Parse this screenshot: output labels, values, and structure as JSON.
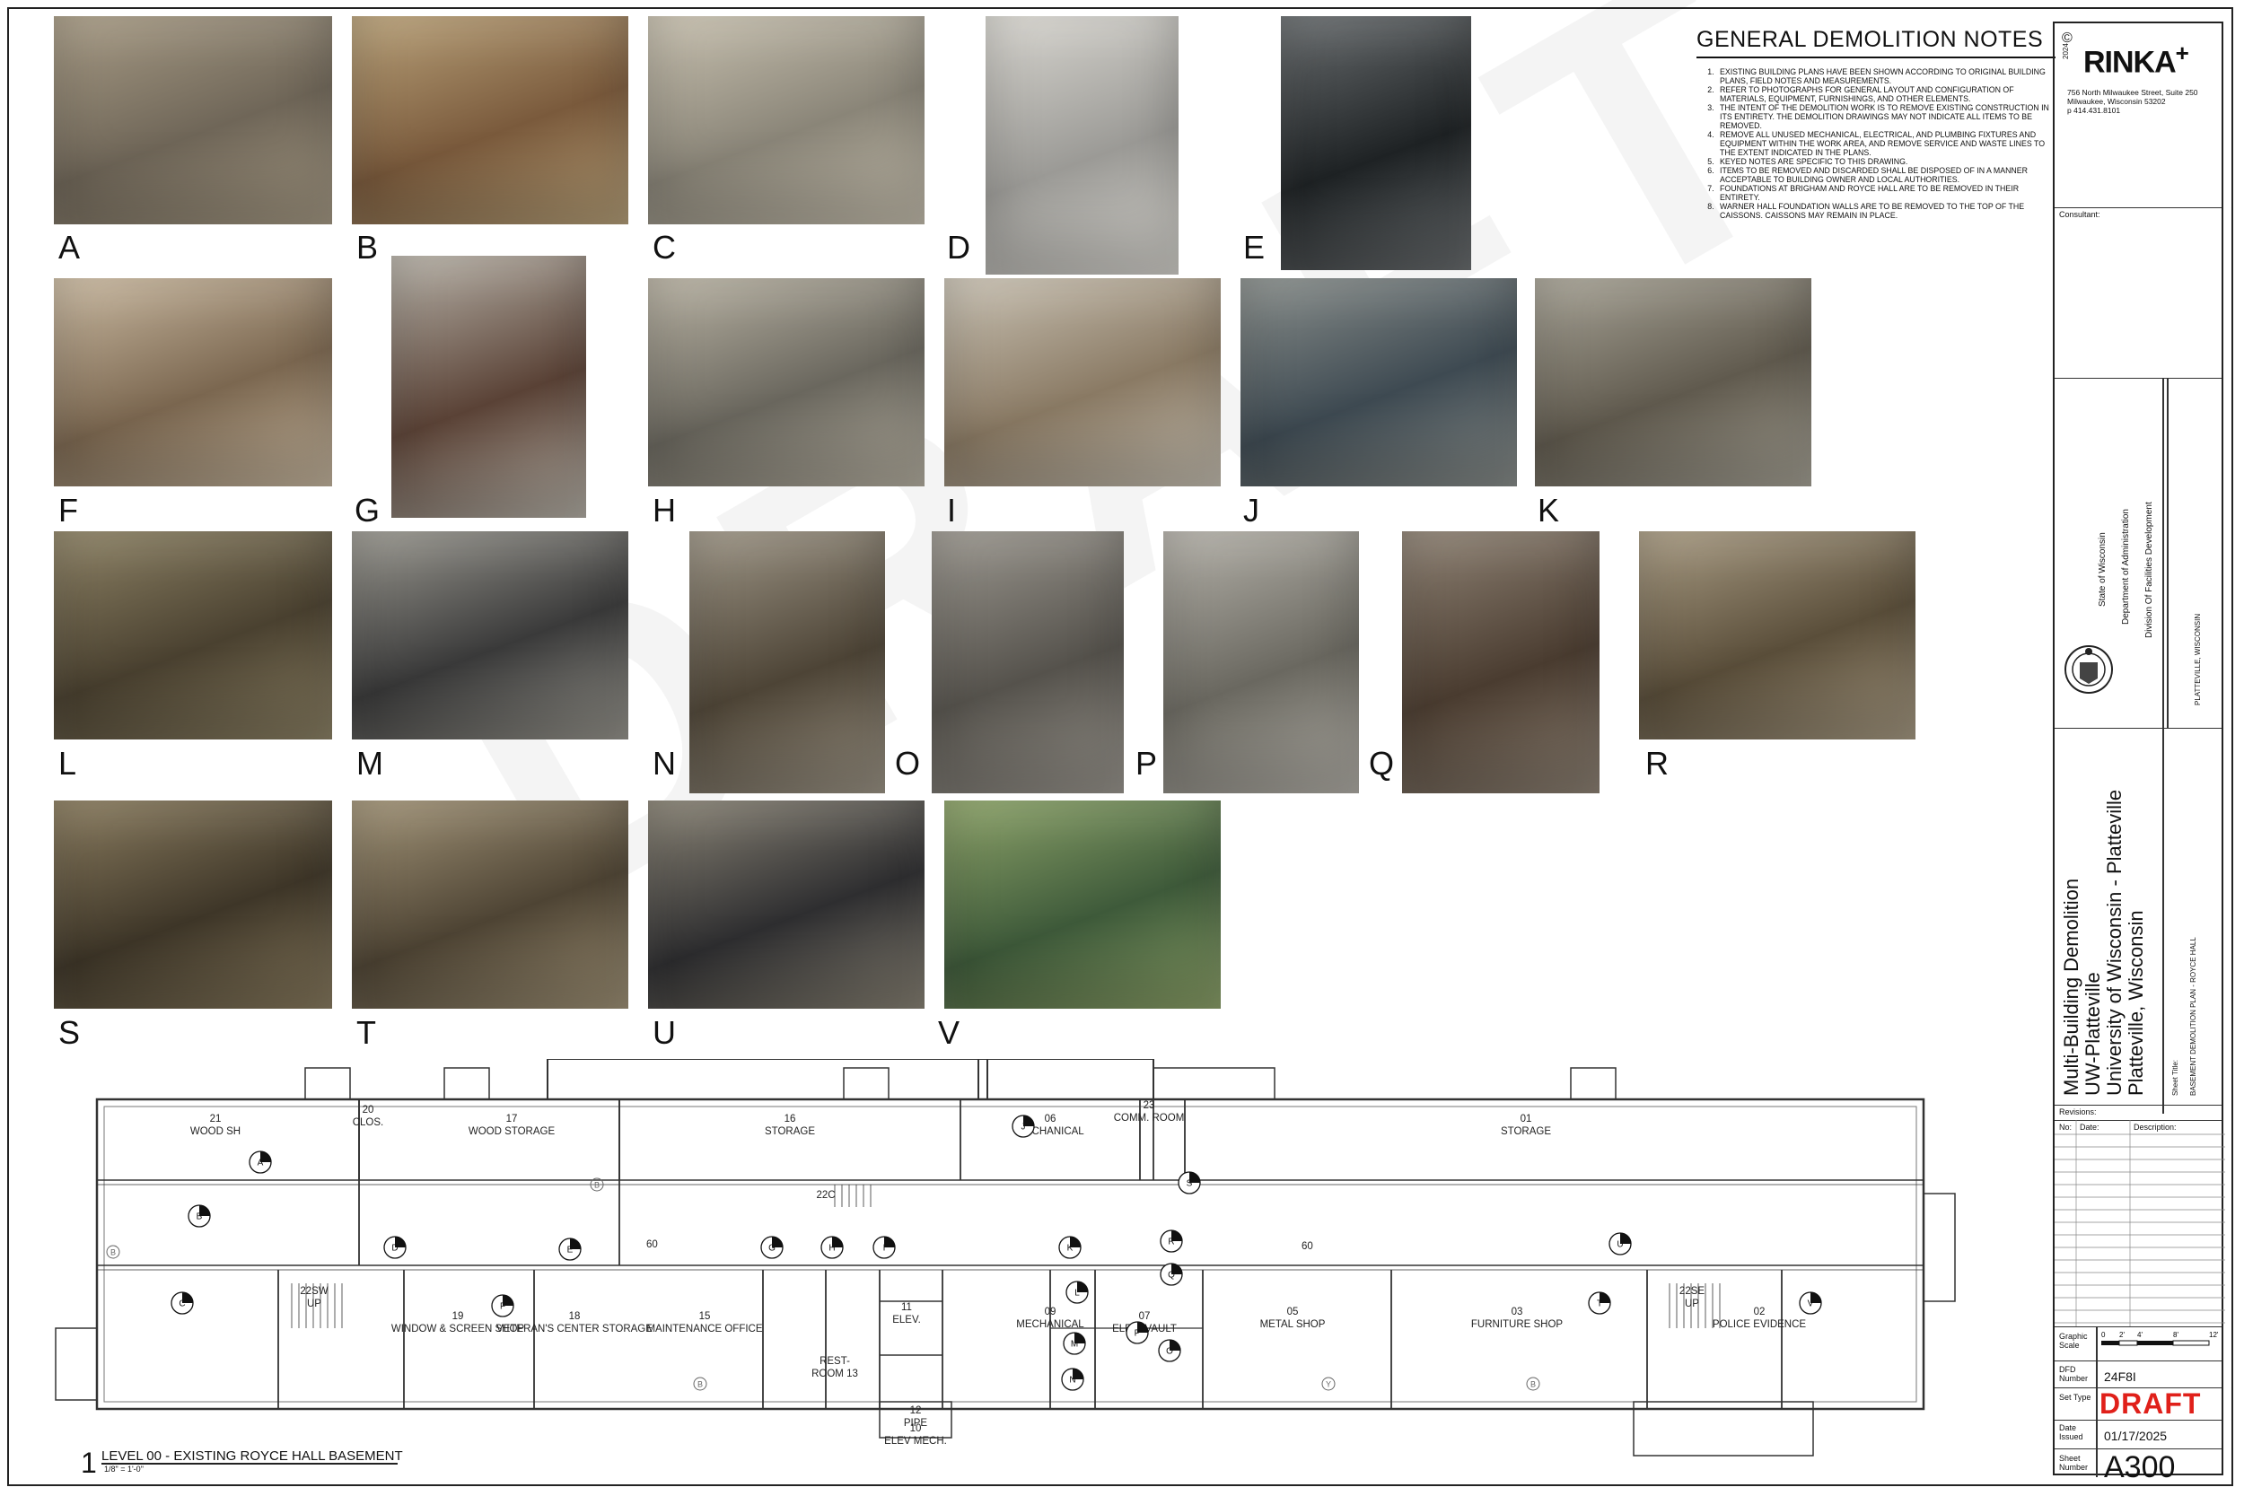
{
  "photos": [
    {
      "label": "A",
      "colors": [
        "#6f6658",
        "#a89c86"
      ]
    },
    {
      "label": "B",
      "colors": [
        "#7a5a3c",
        "#b9a27a"
      ]
    },
    {
      "label": "C",
      "colors": [
        "#8a8578",
        "#c8c1b0"
      ]
    },
    {
      "label": "D",
      "colors": [
        "#9b9a96",
        "#d8d6d0"
      ]
    },
    {
      "label": "E",
      "colors": [
        "#1e2224",
        "#6a6e70"
      ]
    },
    {
      "label": "F",
      "colors": [
        "#7b6750",
        "#c9b9a1"
      ]
    },
    {
      "label": "G",
      "colors": [
        "#5a4236",
        "#b7b2a8"
      ]
    },
    {
      "label": "H",
      "colors": [
        "#6a675e",
        "#b9b3a4"
      ]
    },
    {
      "label": "I",
      "colors": [
        "#8a7a64",
        "#c9c2b4"
      ]
    },
    {
      "label": "J",
      "colors": [
        "#3e4a52",
        "#8a8f8c"
      ]
    },
    {
      "label": "K",
      "colors": [
        "#605a4e",
        "#a8a497"
      ]
    },
    {
      "label": "L",
      "colors": [
        "#4a4130",
        "#8e8366"
      ]
    },
    {
      "label": "M",
      "colors": [
        "#3a3a3a",
        "#9a9890"
      ]
    },
    {
      "label": "N",
      "colors": [
        "#4d4436",
        "#9e9687"
      ]
    },
    {
      "label": "O",
      "colors": [
        "#55524c",
        "#9c9890"
      ]
    },
    {
      "label": "P",
      "colors": [
        "#6a6860",
        "#b5b2aa"
      ]
    },
    {
      "label": "Q",
      "colors": [
        "#4a3c30",
        "#8f8375"
      ]
    },
    {
      "label": "R",
      "colors": [
        "#5a4e3a",
        "#a99c84"
      ]
    },
    {
      "label": "S",
      "colors": [
        "#3e3628",
        "#8b7d60"
      ]
    },
    {
      "label": "T",
      "colors": [
        "#4e4434",
        "#a29478"
      ]
    },
    {
      "label": "U",
      "colors": [
        "#2e2e30",
        "#8a8476"
      ]
    },
    {
      "label": "V",
      "colors": [
        "#3e5a3a",
        "#8ea46a"
      ]
    }
  ],
  "notes": {
    "title": "GENERAL DEMOLITION NOTES",
    "items": [
      "Existing building plans have been shown according to original building plans, field notes and measurements.",
      "Refer to photographs for general layout and configuration of materials, equipment, furnishings, and other elements.",
      "The intent of the demolition work is to remove existing construction in its entirety. The demolition drawings may not indicate all items to be removed.",
      "Remove all unused mechanical, electrical, and plumbing fixtures and equipment within the work area, and remove service and waste lines to the extent indicated in the plans.",
      "Keyed notes are specific to this drawing.",
      "Items to be removed and discarded shall be disposed of in a manner acceptable to building owner and local authorities.",
      "Foundations at Brigham and Royce Hall are to be removed in their entirety.",
      "Warner Hall foundation walls are to be removed to the top of the caissons. Caissons may remain in place."
    ]
  },
  "titleblock": {
    "copyright": "©",
    "year": "2024",
    "firm": "RINKA",
    "firm_plus": "+",
    "address": [
      "756 North Milwaukee Street, Suite 250",
      "Milwaukee, Wisconsin 53202",
      "p 414.431.8101"
    ],
    "consultant_label": "Consultant:",
    "state": [
      "State of Wisconsin",
      "Department of Administration",
      "Division Of Facilities Development"
    ],
    "location": "PLATTEVILLE, WISCONSIN",
    "project_lines": [
      "Multi-Building Demolition",
      "UW-Platteville",
      "University of Wisconsin - Platteville",
      "Platteville, Wisconsin"
    ],
    "sheet_title_label": "Sheet Title:",
    "sheet_title": "BASEMENT DEMOLITION PLAN - ROYCE HALL",
    "revisions_label": "Revisions:",
    "rev_cols": [
      "No:",
      "Date:",
      "Description:"
    ],
    "graphic_scale_label": "Graphic Scale",
    "scale_ticks": [
      "0",
      "2'",
      "4'",
      "8'",
      "12'"
    ],
    "dfd_label": "DFD Number",
    "dfd_value": "24F8I",
    "set_type_label": "Set Type",
    "set_type_value": "DRAFT",
    "date_label": "Date Issued",
    "date_value": "01/17/2025",
    "sheet_number_label": "Sheet Number",
    "sheet_number": "A300"
  },
  "plan": {
    "number": "1",
    "title": "LEVEL 00 - EXISTING ROYCE HALL BASEMENT",
    "scale": "1/8\" = 1'-0\"",
    "watermark": "DRAFT",
    "rooms": [
      {
        "num": "21",
        "name": "WOOD SH"
      },
      {
        "num": "20",
        "name": "CLOS."
      },
      {
        "num": "17",
        "name": "WOOD STORAGE"
      },
      {
        "num": "16",
        "name": "STORAGE"
      },
      {
        "num": "06",
        "name": "MECHANICAL"
      },
      {
        "num": "23",
        "name": "COMM. ROOM"
      },
      {
        "num": "01",
        "name": "STORAGE"
      },
      {
        "num": "22SW",
        "name": "UP"
      },
      {
        "num": "19",
        "name": "WINDOW & SCREEN SHOP"
      },
      {
        "num": "18",
        "name": "VETERAN'S CENTER STORAGE"
      },
      {
        "num": "15",
        "name": "MAINTENANCE OFFICE"
      },
      {
        "num": "22C",
        "name": ""
      },
      {
        "num": "11",
        "name": "ELEV."
      },
      {
        "num": "REST-",
        "name": "ROOM 13"
      },
      {
        "num": "12",
        "name": "PIPE"
      },
      {
        "num": "10",
        "name": "ELEV MECH."
      },
      {
        "num": "09",
        "name": "MECHANICAL"
      },
      {
        "num": "07",
        "name": "ELEC. VAULT"
      },
      {
        "num": "05",
        "name": "METAL SHOP"
      },
      {
        "num": "03",
        "name": "FURNITURE SHOP"
      },
      {
        "num": "22SE",
        "name": "UP"
      },
      {
        "num": "02",
        "name": "POLICE EVIDENCE"
      }
    ],
    "corridor": "60",
    "keys": [
      "A",
      "B",
      "C",
      "D",
      "E",
      "F",
      "G",
      "H",
      "I",
      "J",
      "K",
      "L",
      "M",
      "N",
      "O",
      "P",
      "Q",
      "R",
      "S",
      "T",
      "U",
      "V"
    ],
    "gridmarks": [
      "B",
      "Y"
    ]
  }
}
